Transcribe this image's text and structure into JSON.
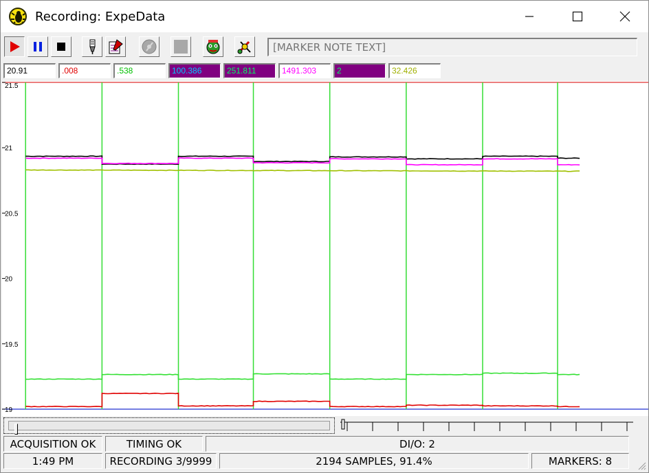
{
  "window": {
    "title": "Recording: ExpeData"
  },
  "toolbar": {
    "buttons": [
      {
        "name": "record-button",
        "icon": "record-icon"
      },
      {
        "name": "pause-button",
        "icon": "pause-icon"
      },
      {
        "name": "stop-button",
        "icon": "stop-icon"
      },
      {
        "name": "marker-pen-button",
        "icon": "pen-icon"
      },
      {
        "name": "notes-button",
        "icon": "notepad-icon"
      },
      {
        "name": "disk-button",
        "icon": "disk-icon"
      },
      {
        "name": "blank-button",
        "icon": "blank-icon"
      },
      {
        "name": "bug-button",
        "icon": "bug-icon"
      },
      {
        "name": "settings-button",
        "icon": "tools-icon"
      }
    ],
    "marker_placeholder": "[MARKER NOTE TEXT]"
  },
  "readouts": [
    {
      "value": "20.91",
      "color": "#000000",
      "bg": "#ffffff"
    },
    {
      "value": ".008",
      "color": "#e00000",
      "bg": "#ffffff"
    },
    {
      "value": ".538",
      "color": "#00c000",
      "bg": "#ffffff"
    },
    {
      "value": "100.386",
      "color": "#00c8ff",
      "bg": "#800080"
    },
    {
      "value": "251.811",
      "color": "#00ff60",
      "bg": "#800080"
    },
    {
      "value": "1491.303",
      "color": "#ff00ff",
      "bg": "#ffffff"
    },
    {
      "value": "2",
      "color": "#00ff60",
      "bg": "#800080"
    },
    {
      "value": "32.426",
      "color": "#a0b000",
      "bg": "#ffffff"
    }
  ],
  "chart_data": {
    "type": "line",
    "ylim": [
      19,
      21.5
    ],
    "y_ticks": [
      "21.5",
      "21",
      "20.5",
      "20",
      "19.5",
      "19"
    ],
    "xlim": [
      0,
      2194
    ],
    "grid": false,
    "marker_x": [
      80,
      340,
      600,
      855,
      1115,
      1375,
      1635,
      1890
    ],
    "limit_lines": [
      {
        "y": 21.5,
        "color": "#e03030"
      },
      {
        "y": 19.0,
        "color": "#2030d0"
      }
    ],
    "series": [
      {
        "color": "#000000",
        "segments": [
          {
            "x": [
              80,
              340
            ],
            "y": 20.935
          },
          {
            "x": [
              340,
              600
            ],
            "y": 20.875
          },
          {
            "x": [
              600,
              855
            ],
            "y": 20.935
          },
          {
            "x": [
              855,
              1115
            ],
            "y": 20.895
          },
          {
            "x": [
              1115,
              1375
            ],
            "y": 20.93
          },
          {
            "x": [
              1375,
              1635
            ],
            "y": 20.915
          },
          {
            "x": [
              1635,
              1890
            ],
            "y": 20.935
          },
          {
            "x": [
              1890,
              1965
            ],
            "y": 20.92
          }
        ]
      },
      {
        "color": "#ff00ff",
        "segments": [
          {
            "x": [
              80,
              340
            ],
            "y": 20.92
          },
          {
            "x": [
              340,
              600
            ],
            "y": 20.88
          },
          {
            "x": [
              600,
              855
            ],
            "y": 20.92
          },
          {
            "x": [
              855,
              1115
            ],
            "y": 20.885
          },
          {
            "x": [
              1115,
              1375
            ],
            "y": 20.915
          },
          {
            "x": [
              1375,
              1635
            ],
            "y": 20.87
          },
          {
            "x": [
              1635,
              1890
            ],
            "y": 20.915
          },
          {
            "x": [
              1890,
              1965
            ],
            "y": 20.87
          }
        ]
      },
      {
        "color": "#a0c000",
        "segments": [
          {
            "x": [
              80,
              1965
            ],
            "y": [
              20.83,
              20.82
            ]
          }
        ]
      },
      {
        "color": "#33e033",
        "segments": [
          {
            "x": [
              80,
              340
            ],
            "y": 19.23
          },
          {
            "x": [
              340,
              600
            ],
            "y": 19.265
          },
          {
            "x": [
              600,
              855
            ],
            "y": 19.23
          },
          {
            "x": [
              855,
              1115
            ],
            "y": 19.27
          },
          {
            "x": [
              1115,
              1375
            ],
            "y": 19.23
          },
          {
            "x": [
              1375,
              1635
            ],
            "y": 19.265
          },
          {
            "x": [
              1635,
              1890
            ],
            "y": 19.275
          },
          {
            "x": [
              1890,
              1965
            ],
            "y": 19.265
          }
        ]
      },
      {
        "color": "#e00000",
        "segments": [
          {
            "x": [
              80,
              340
            ],
            "y": 19.02
          },
          {
            "x": [
              340,
              600
            ],
            "y": 19.12
          },
          {
            "x": [
              600,
              855
            ],
            "y": 19.025
          },
          {
            "x": [
              855,
              1115
            ],
            "y": 19.06
          },
          {
            "x": [
              1115,
              1375
            ],
            "y": 19.02
          },
          {
            "x": [
              1375,
              1635
            ],
            "y": 19.03
          },
          {
            "x": [
              1635,
              1890
            ],
            "y": 19.025
          },
          {
            "x": [
              1890,
              1965
            ],
            "y": 19.02
          }
        ]
      }
    ]
  },
  "status": {
    "row1": [
      "ACQUISITION OK",
      "TIMING OK",
      "DI/O: 2"
    ],
    "row2": [
      "1:49 PM",
      "RECORDING 3/9999",
      "2194 SAMPLES, 91.4%",
      "MARKERS: 8"
    ]
  }
}
